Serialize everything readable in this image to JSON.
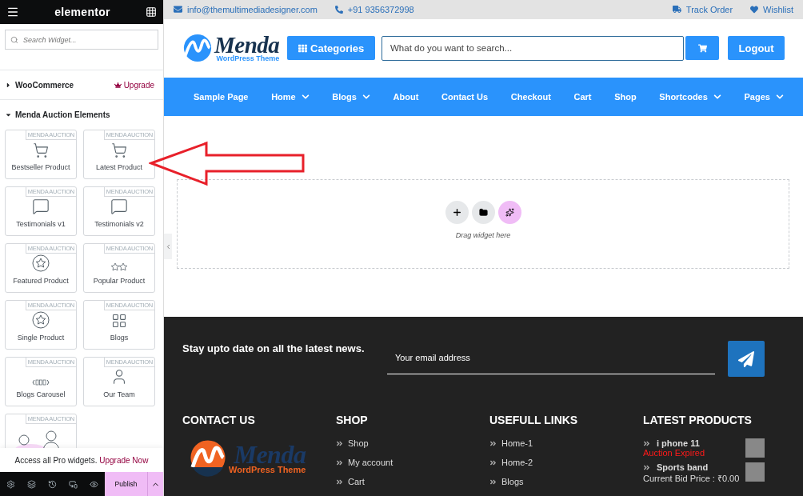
{
  "editor": {
    "brand": "elementor",
    "search": {
      "placeholder": "Search Widget..."
    },
    "categories": [
      {
        "label": "WooCommerce",
        "expanded": false,
        "badge": "Upgrade"
      },
      {
        "label": "Menda Auction Elements",
        "expanded": true
      }
    ],
    "widgets": [
      {
        "tag": "MENDA AUCTION",
        "label": "Bestseller Product",
        "kind": "cart"
      },
      {
        "tag": "MENDA AUCTION",
        "label": "Latest Product",
        "kind": "cart"
      },
      {
        "tag": "MENDA AUCTION",
        "label": "Testimonials v1",
        "kind": "chat"
      },
      {
        "tag": "MENDA AUCTION",
        "label": "Testimonials v2",
        "kind": "chat"
      },
      {
        "tag": "MENDA AUCTION",
        "label": "Featured Product",
        "kind": "star"
      },
      {
        "tag": "MENDA AUCTION",
        "label": "Popular Product",
        "kind": "stars"
      },
      {
        "tag": "MENDA AUCTION",
        "label": "Single Product",
        "kind": "star"
      },
      {
        "tag": "MENDA AUCTION",
        "label": "Blogs",
        "kind": "grid"
      },
      {
        "tag": "MENDA AUCTION",
        "label": "Blogs Carousel",
        "kind": "carousel"
      },
      {
        "tag": "MENDA AUCTION",
        "label": "Our Team",
        "kind": "person"
      },
      {
        "tag": "MENDA AUCTION",
        "kind": "illustration"
      }
    ],
    "promo": {
      "text": "Access all Pro widgets.",
      "link": "Upgrade Now"
    },
    "publish": "Publish"
  },
  "topbar": {
    "email": "info@themultimediadesigner.com",
    "phone": "+91 9356372998",
    "links": [
      {
        "label": "Track Order",
        "kind": "truck"
      },
      {
        "label": "Wishlist",
        "kind": "heart"
      }
    ]
  },
  "header": {
    "logo": {
      "name": "Menda",
      "tagline": "WordPress Theme"
    },
    "categories_button": "Categories",
    "search": {
      "placeholder": "What do you want to search..."
    },
    "logout": "Logout"
  },
  "nav": [
    {
      "label": "Sample Page",
      "dropdown": false
    },
    {
      "label": "Home",
      "dropdown": true
    },
    {
      "label": "Blogs",
      "dropdown": true
    },
    {
      "label": "About",
      "dropdown": false
    },
    {
      "label": "Contact Us",
      "dropdown": false
    },
    {
      "label": "Checkout",
      "dropdown": false
    },
    {
      "label": "Cart",
      "dropdown": false
    },
    {
      "label": "Shop",
      "dropdown": false
    },
    {
      "label": "Shortcodes",
      "dropdown": true
    },
    {
      "label": "Pages",
      "dropdown": true
    }
  ],
  "canvas": {
    "hint": "Drag widget here"
  },
  "footer": {
    "newsletter": {
      "heading": "Stay upto date on all the latest news.",
      "placeholder": "Your email address"
    },
    "contact": {
      "heading": "CONTACT US",
      "logo": {
        "name": "Menda",
        "tagline": "WordPress Theme"
      }
    },
    "shop": {
      "heading": "SHOP",
      "links": [
        "Shop",
        "My account",
        "Cart"
      ]
    },
    "useful": {
      "heading": "USEFULL LINKS",
      "links": [
        "Home-1",
        "Home-2",
        "Blogs"
      ]
    },
    "latest": {
      "heading": "LATEST PRODUCTS",
      "products": [
        {
          "name": "i phone 11",
          "detail": "Auction Expired",
          "kind": "expired"
        },
        {
          "name": "Sports band",
          "detail": "Current Bid Price : ₹0.00",
          "kind": "price"
        }
      ]
    }
  }
}
